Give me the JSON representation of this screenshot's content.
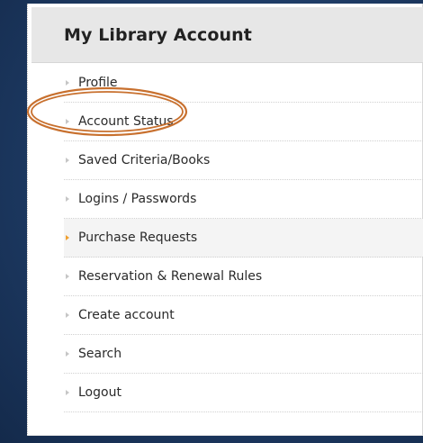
{
  "panel": {
    "title": "My Library Account"
  },
  "menu": {
    "items": [
      {
        "label": "Profile"
      },
      {
        "label": "Account Status"
      },
      {
        "label": "Saved Criteria/Books"
      },
      {
        "label": "Logins / Passwords"
      },
      {
        "label": "Purchase Requests"
      },
      {
        "label": "Reservation & Renewal Rules"
      },
      {
        "label": "Create account"
      },
      {
        "label": "Search"
      },
      {
        "label": "Logout"
      }
    ],
    "active_index": 4,
    "highlighted_index": 1
  },
  "colors": {
    "background": "#1d3a63",
    "header": "#e7e7e7",
    "active_bullet": "#f0a030",
    "highlight_ring": "#c8702e"
  }
}
